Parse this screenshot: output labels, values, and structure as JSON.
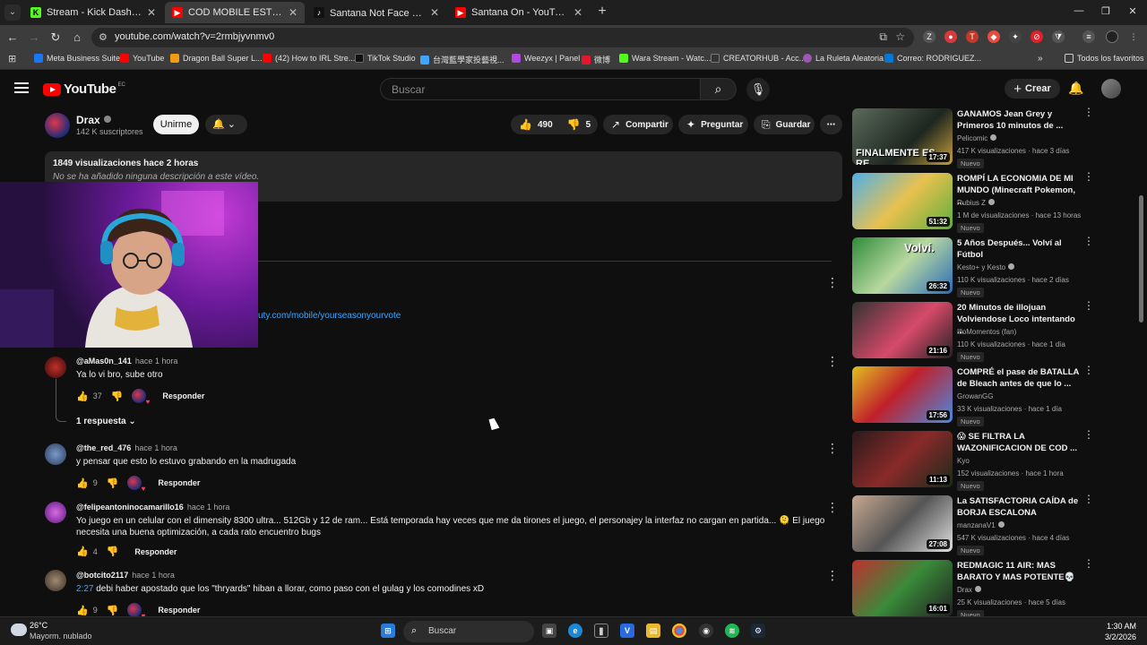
{
  "browser": {
    "tabs": [
      {
        "title": "Stream - Kick Dashboard",
        "icon": "kick-icon",
        "color": "#53fc18",
        "active": false
      },
      {
        "title": "COD MOBILE ESTÁ CAYENDO E",
        "icon": "youtube-icon",
        "color": "#ff0000",
        "active": true
      },
      {
        "title": "Santana Not Face 🕵 (@santan",
        "icon": "tiktok-icon",
        "color": "#000000",
        "active": false
      },
      {
        "title": "Santana On - YouTube",
        "icon": "youtube-icon",
        "color": "#ff0000",
        "active": false
      }
    ],
    "url": "youtube.com/watch?v=2rmbjyvnmv0",
    "bookmarks": [
      {
        "label": "Meta Business Suite",
        "color": "#1877f2"
      },
      {
        "label": "YouTube",
        "color": "#ff0000"
      },
      {
        "label": "Dragon Ball Super L...",
        "color": "#f39c12"
      },
      {
        "label": "(42) How to IRL Stre...",
        "color": "#ff0000"
      },
      {
        "label": "TikTok Studio",
        "color": "#111111"
      },
      {
        "label": "台灣藍學家投藝視...",
        "color": "#3ea6ff"
      },
      {
        "label": "Weezyx | Panel",
        "color": "#b04ae0"
      },
      {
        "label": "微博",
        "color": "#e6162d"
      },
      {
        "label": "Wara Stream - Watc...",
        "color": "#53fc18"
      },
      {
        "label": "CREATORHUB - Acc...",
        "color": "#333333"
      },
      {
        "label": "La Ruleta Aleatoria",
        "color": "#9b59b6"
      },
      {
        "label": "Correo: RODRIGUEZ...",
        "color": "#0078d4"
      }
    ],
    "all_bookmarks": "Todos los favoritos"
  },
  "youtube": {
    "logo": "YouTube",
    "country": "EC",
    "search_placeholder": "Buscar",
    "create_label": "Crear"
  },
  "video": {
    "channel_name": "Drax",
    "subscribers": "142 K suscriptores",
    "join_label": "Unirme",
    "likes": "490",
    "dislikes": "5",
    "share_label": "Compartir",
    "ask_label": "Preguntar",
    "save_label": "Guardar",
    "views_time": "1849 visualizaciones  hace 2 horas",
    "description": "No se ha añadido ninguna descripción a este vídeo.",
    "pinned_link": "uty.com/mobile/yourseasonyourvote"
  },
  "comments": [
    {
      "user": "@aMas0n_141",
      "time": "hace 1 hora",
      "text": "Ya lo vi bro, sube otro",
      "likes": "37",
      "reply_label": "Responder",
      "replies": "1 respuesta",
      "avatar_color": "#7a1f1f"
    },
    {
      "user": "@the_red_476",
      "time": "hace 1 hora",
      "text": "y pensar que esto lo estuvo grabando en la madrugada",
      "likes": "9",
      "reply_label": "Responder",
      "avatar_color": "#3b5a8a"
    },
    {
      "user": "@felipeantoninocamarillo16",
      "time": "hace 1 hora",
      "text": "Yo juego en un celular con el dimensity 8300 ultra... 512Gb y 12 de ram... Está temporada hay veces que me da tirones el juego, el personajey la interfaz no cargan en partida... 🫠 El juego necesita una buena optimización, a cada rato encuentro bugs",
      "likes": "4",
      "reply_label": "Responder",
      "avatar_color": "#a33bc2"
    },
    {
      "user": "@botcito2117",
      "time": "hace 1 hora",
      "timestamp": "2:27",
      "text": " debi haber apostado que los \"thryards\" hiban a llorar, como paso con el gulag y los comodines xD",
      "likes": "9",
      "reply_label": "Responder",
      "avatar_color": "#6b5a4a"
    }
  ],
  "recommendations": [
    {
      "title": "GANAMOS Jean Grey y Primeros 10 minutos de ...",
      "channel": "Pelicomic",
      "verified": true,
      "views": "417 K visualizaciones · hace 3 días",
      "duration": "17:37",
      "badge": "Nuevo",
      "overlay": "FINALMENTE ES RE...",
      "bg": "linear-gradient(135deg,#5b6b5a,#1d2620 60%,#c9a03a)"
    },
    {
      "title": "ROMPÍ LA ECONOMIA DE MI MUNDO (Minecraft Pokemon, ...",
      "channel": "Rubius Z",
      "verified": true,
      "views": "1 M de visualizaciones · hace 13 horas",
      "duration": "51:32",
      "badge": "Nuevo",
      "overlay": "",
      "bg": "linear-gradient(135deg,#4fb0e8,#e8c14f 50%,#5fae3c)"
    },
    {
      "title": "5 Años Después... Volví al Fútbol",
      "channel": "Kesto+ y Kesto",
      "verified": true,
      "views": "110 K visualizaciones · hace 2 días",
      "duration": "26:32",
      "badge": "Nuevo",
      "overlay": "Volví.",
      "bg": "linear-gradient(135deg,#2e8b3a,#b8d8a0 50%,#2a6bb8)"
    },
    {
      "title": "20 Minutos de illojuan Volviendose Loco intentando ...",
      "channel": "IlloMomentos (fan)",
      "verified": false,
      "views": "110 K visualizaciones · hace 1 día",
      "duration": "21:16",
      "badge": "Nuevo",
      "overlay": "",
      "bg": "linear-gradient(135deg,#333,#d84a6a 55%,#222)"
    },
    {
      "title": "COMPRÉ el pase de BATALLA de Bleach antes de que lo ...",
      "channel": "GrowanGG",
      "verified": false,
      "views": "33 K visualizaciones · hace 1 día",
      "duration": "17:56",
      "badge": "Nuevo",
      "overlay": "",
      "bg": "linear-gradient(135deg,#e0c020,#c0202a 45%,#4a8ae0)"
    },
    {
      "title": "😱 SE FILTRA LA WAZONIFICACION DE COD ...",
      "channel": "Kyo",
      "verified": false,
      "views": "152 visualizaciones · hace 1 hora",
      "duration": "11:13",
      "badge": "Nuevo",
      "overlay": "",
      "bg": "linear-gradient(135deg,#2a1a1a,#8a2a2a 50%,#1a2a1a)"
    },
    {
      "title": "La SATISFACTORIA CAÍDA de BORJA ESCALONA",
      "channel": "manzanaV1",
      "verified": true,
      "views": "547 K visualizaciones · hace 4 días",
      "duration": "27:08",
      "badge": "Nuevo",
      "overlay": "",
      "bg": "linear-gradient(135deg,#c8a890,#555 50%,#e0e0e0)"
    },
    {
      "title": "REDMAGIC 11 AIR: MAS BARATO Y MAS POTENTE💀",
      "channel": "Drax",
      "verified": true,
      "views": "25 K visualizaciones · hace 5 días",
      "duration": "16:01",
      "badge": "Nuevo",
      "overlay": "",
      "bg": "linear-gradient(135deg,#c03030,#3a8a3a 50%,#202020)"
    }
  ],
  "taskbar": {
    "temperature": "26°C",
    "weather": "Mayorm. nublado",
    "search_label": "Buscar",
    "time": "1:30 AM",
    "date": "3/2/2026"
  }
}
